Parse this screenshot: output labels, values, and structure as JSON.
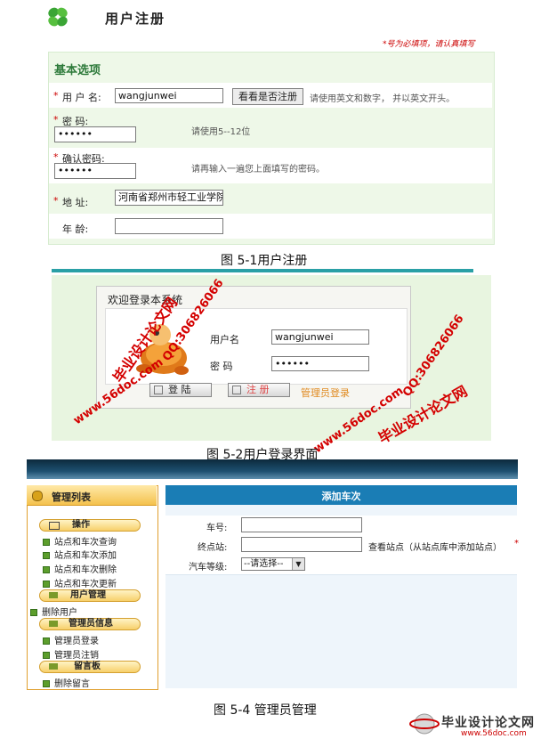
{
  "fig1": {
    "title": "用户注册",
    "required_note": "*号为必填项，请认真填写",
    "section_title": "基本选项",
    "star": "*",
    "fields": {
      "username": {
        "label": "用 户 名:",
        "value": "wangjunwei",
        "button": "看看是否注册",
        "hint": "请使用英文和数字，  并以英文开头。"
      },
      "password": {
        "label": "密      码:",
        "value": "••••••",
        "hint": "请使用5--12位"
      },
      "confirm": {
        "label": "确认密码:",
        "value": "••••••",
        "hint": "请再输入一遍您上面填写的密码。"
      },
      "address": {
        "label": "地      址:",
        "value": "河南省郑州市轻工业学院"
      },
      "age": {
        "label": "年      龄:",
        "value": ""
      }
    },
    "caption": "图 5-1用户注册"
  },
  "fig2": {
    "welcome": "欢迎登录本系统",
    "username_label": "用户名",
    "username_value": "wangjunwei",
    "password_label": "密    码",
    "password_value": "••••••",
    "login_button": "登    陆",
    "register_button": "注    册",
    "admin_link": "管理员登录",
    "caption": "图 5-2用户登录界面"
  },
  "watermarks": {
    "brand": "毕业设计论文网",
    "qq": "QQ:306826066",
    "site": "www.56doc.com"
  },
  "fig4": {
    "sidebar_title": "管理列表",
    "groups": [
      {
        "label": "操作",
        "items": [
          "站点和车次查询",
          "站点和车次添加",
          "站点和车次删除",
          "站点和车次更新"
        ]
      },
      {
        "label": "用户管理",
        "items": [
          "删除用户"
        ]
      },
      {
        "label": "管理员信息",
        "items": [
          "管理员登录",
          "管理员注销"
        ]
      },
      {
        "label": "留言板",
        "items": [
          "删除留言"
        ]
      }
    ],
    "form_title": "添加车次",
    "train_label": "车号:",
    "terminal_label": "终点站:",
    "view_stations": "查看站点（从站点库中添加站点）",
    "star": "*",
    "grade_label": "汽车等级:",
    "grade_selected": "--请选择--",
    "caption": "图 5-4 管理员管理"
  },
  "footer": {
    "brand": "毕业设计论文网",
    "site": "www.56doc.com"
  },
  "colors": {
    "accent_green": "#2d7a3a",
    "required_red": "#cc0000",
    "header_blue": "#1a7db5",
    "sidebar_gold": "#f4c24e"
  }
}
